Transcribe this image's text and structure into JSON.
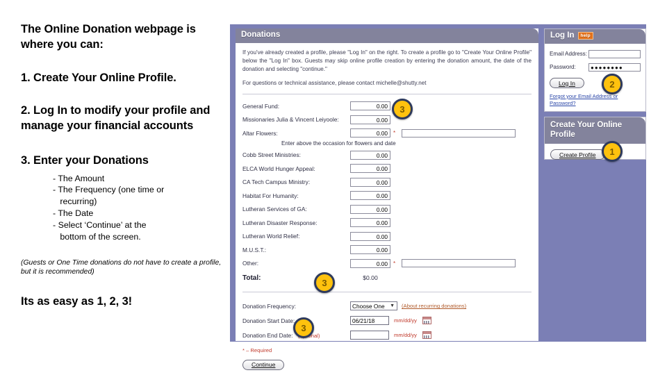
{
  "slide": {
    "left_column": {
      "lead": "The Online Donation webpage is where you can:",
      "step1": "1. Create Your Online Profile.",
      "step2": "2. Log In to modify your profile and manage your financial accounts",
      "step3": "3. Enter your Donations",
      "sub_items": [
        "- The Amount",
        "- The Frequency (one time or",
        "   recurring)",
        "- The Date",
        "- Select ‘Continue’ at the",
        "   bottom of the screen."
      ],
      "note": "(Guests or One Time donations do not have to create a profile, but it is recommended)",
      "closing": "Its as easy as 1, 2, 3!"
    },
    "callouts": [
      {
        "id": "1",
        "label": "1"
      },
      {
        "id": "2",
        "label": "2"
      },
      {
        "id": "3a",
        "label": "3"
      },
      {
        "id": "3b",
        "label": "3"
      },
      {
        "id": "3c",
        "label": "3"
      }
    ],
    "colors": {
      "page_backdrop": "#7b7fb5",
      "panel_header": "#83839c",
      "badge_fill": "#ffc20e",
      "badge_ring": "#2e3a5c",
      "required_red": "#c0392b",
      "link_orange": "#b05a2a",
      "link_blue": "#2b47a8",
      "help_orange": "#e2721c"
    }
  },
  "donations_panel": {
    "title": "Donations",
    "intro_paragraph": "If you've already created a profile, please \"Log In\" on the right. To create a profile go to \"Create Your Online Profile\" below the \"Log In\" box.  Guests may skip online profile creation by entering the donation amount, the date of the donation and selecting \"continue.\"",
    "contact_paragraph": "For questions or technical assistance, please contact michelle@shutty.net",
    "funds": [
      {
        "label": "General Fund:",
        "amount": "0.00",
        "has_text_field": false,
        "required": false
      },
      {
        "label": "Missionaries   Julia & Vincent Leiyoole:",
        "amount": "0.00",
        "has_text_field": false,
        "required": false
      },
      {
        "label": "Altar Flowers:",
        "amount": "0.00",
        "has_text_field": true,
        "required": true
      },
      {
        "label": "Cobb Street Ministries:",
        "amount": "0.00",
        "has_text_field": false,
        "required": false
      },
      {
        "label": "ELCA World Hunger Appeal:",
        "amount": "0.00",
        "has_text_field": false,
        "required": false
      },
      {
        "label": "CA Tech Campus Ministry:",
        "amount": "0.00",
        "has_text_field": false,
        "required": false
      },
      {
        "label": "Habitat For Humanity:",
        "amount": "0.00",
        "has_text_field": false,
        "required": false
      },
      {
        "label": "Lutheran Services of GA:",
        "amount": "0.00",
        "has_text_field": false,
        "required": false
      },
      {
        "label": "Lutheran Disaster Response:",
        "amount": "0.00",
        "has_text_field": false,
        "required": false
      },
      {
        "label": "Lutheran World Relief:",
        "amount": "0.00",
        "has_text_field": false,
        "required": false
      },
      {
        "label": "M.U.S.T.:",
        "amount": "0.00",
        "has_text_field": false,
        "required": false
      },
      {
        "label": "Other:",
        "amount": "0.00",
        "has_text_field": true,
        "required": true
      }
    ],
    "flowers_hint": "Enter above the occasion for flowers and date",
    "total_label": "Total:",
    "total_value": "$0.00",
    "frequency_label": "Donation Frequency:",
    "frequency_value": "Choose One",
    "frequency_link": "(About recurring donations)",
    "start_date_label": "Donation Start Date:",
    "start_date_value": "06/21/18",
    "end_date_label": "Donation End Date:",
    "end_date_optional": "(optional)",
    "end_date_value": "",
    "date_format_hint": "mm/dd/yy",
    "required_note": "* – Required",
    "continue_button": "Continue"
  },
  "login_panel": {
    "title": "Log In",
    "help_badge": "help",
    "email_label": "Email Address:",
    "email_value": "",
    "password_label": "Password:",
    "password_value": "●●●●●●●●",
    "login_button": "Log In",
    "forgot_link": "Forgot your Email Address or Password?"
  },
  "create_panel": {
    "title": "Create Your Online Profile",
    "create_button": "Create Profile"
  }
}
